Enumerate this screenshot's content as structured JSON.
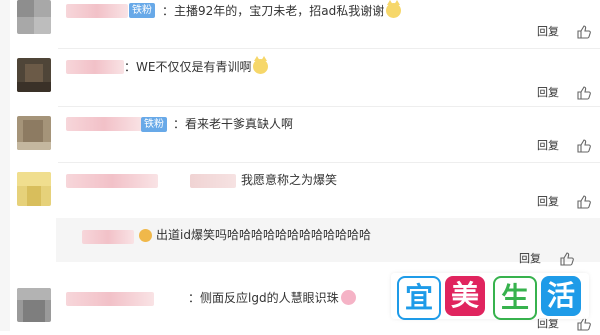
{
  "comments": [
    {
      "badge": "铁粉",
      "text": "：主播92年的，宝刀未老，招ad私我谢谢",
      "emoji": "cat-emoji",
      "reply": "回复"
    },
    {
      "badge": "",
      "text": "：WE不仅仅是有青训啊",
      "emoji": "cat-emoji",
      "reply": "回复"
    },
    {
      "badge": "铁粉",
      "text": "：看来老干爹真缺人啊",
      "emoji": "",
      "reply": "回复"
    },
    {
      "badge": "",
      "text": "我愿意称之为爆笑",
      "emoji": "",
      "reply": "回复"
    },
    {
      "badge": "",
      "text": "：侧面反应lgd的人慧眼识珠",
      "emoji": "pig-emoji",
      "reply": "回复"
    }
  ],
  "subreply": {
    "text": "出道id爆笑吗哈哈哈哈哈哈哈哈哈哈哈哈",
    "emoji": "crown-emoji",
    "reply": "回复"
  },
  "watermark": {
    "chars": [
      "宜",
      "美",
      "生",
      "活"
    ],
    "colors": [
      "#1e9be8",
      "#e0245e",
      "#37b24d",
      "#1e9be8"
    ]
  },
  "colors": {
    "badge": "#68a9e8",
    "username_blur": "#f2c1c8",
    "subreply_bg": "#f5f5f5"
  }
}
